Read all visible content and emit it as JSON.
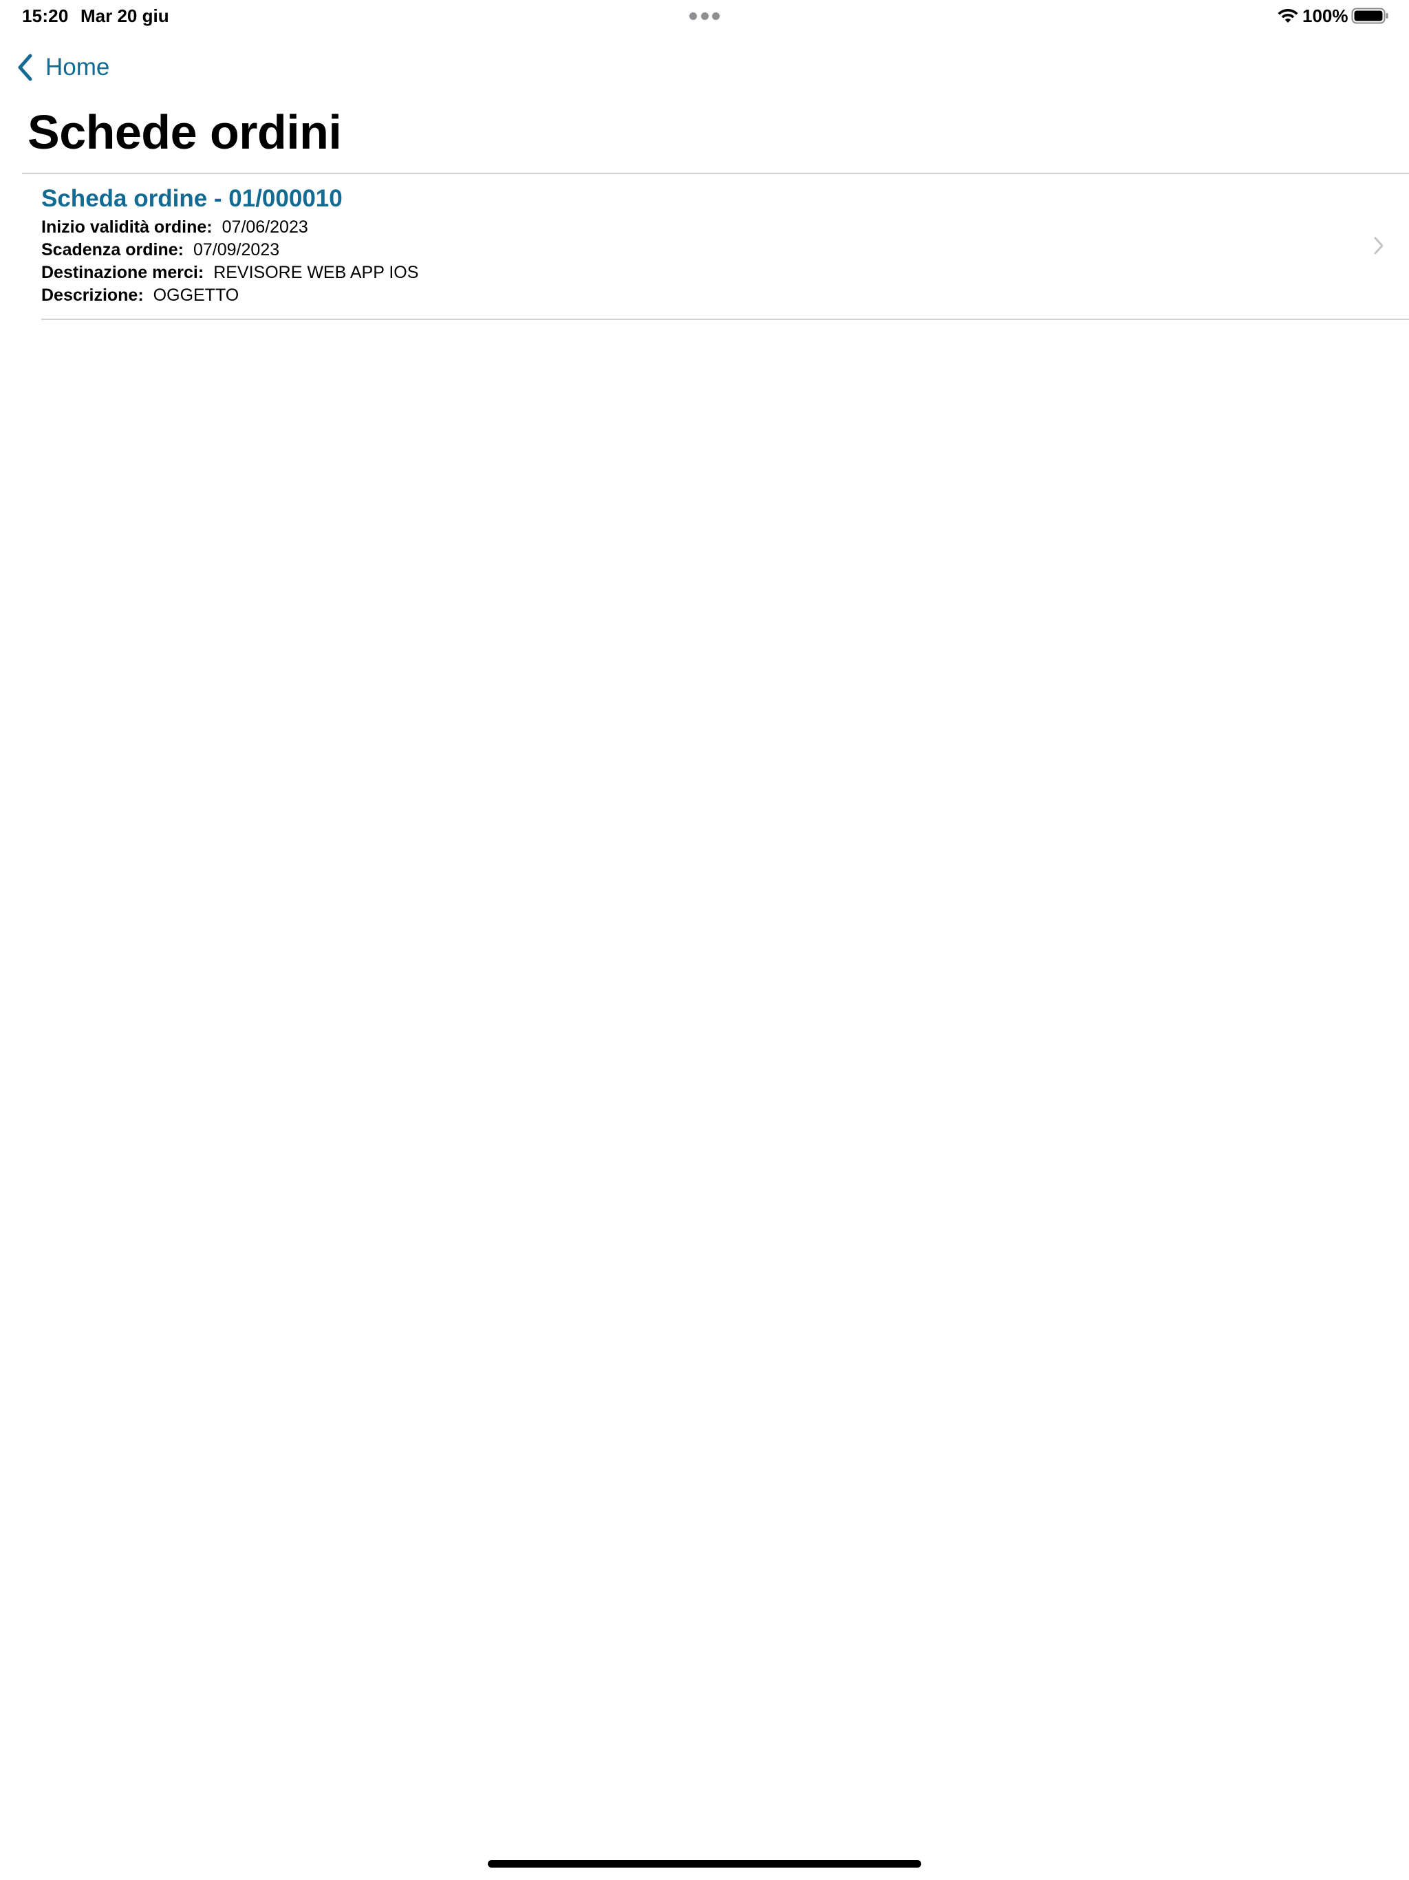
{
  "status_bar": {
    "time": "15:20",
    "date": "Mar 20 giu",
    "battery_percent": "100%",
    "wifi_icon": "wifi-icon",
    "battery_icon": "battery-full-icon",
    "multitasking_icon": "multitasking-dots-icon"
  },
  "nav": {
    "back_label": "Home",
    "back_icon": "chevron-left-icon"
  },
  "page": {
    "title": "Schede ordini"
  },
  "orders": [
    {
      "title": "Scheda ordine - 01/000010",
      "fields": [
        {
          "label": "Inizio validità ordine:",
          "value": "07/06/2023"
        },
        {
          "label": "Scadenza ordine:",
          "value": "07/09/2023"
        },
        {
          "label": "Destinazione merci:",
          "value": "REVISORE WEB APP IOS"
        },
        {
          "label": "Descrizione:",
          "value": "OGGETTO"
        }
      ],
      "disclosure_icon": "chevron-right-icon"
    }
  ],
  "colors": {
    "accent": "#136a92",
    "separator": "#d1d1d6",
    "disclosure": "#c4c4c7",
    "text": "#000000",
    "background": "#ffffff"
  }
}
